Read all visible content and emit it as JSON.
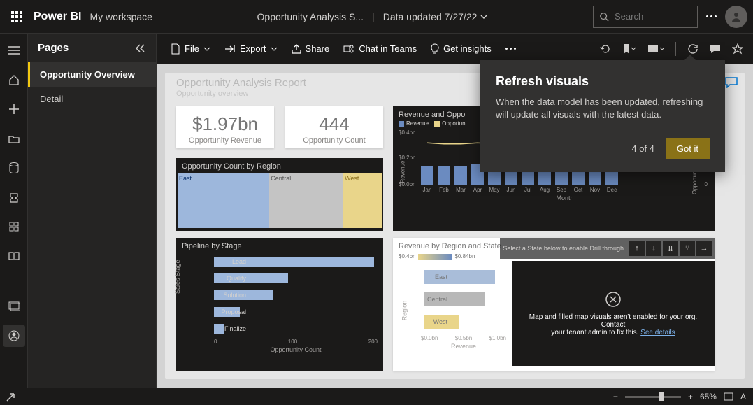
{
  "top": {
    "brand": "Power BI",
    "workspace": "My workspace",
    "report_name": "Opportunity Analysis S...",
    "data_updated": "Data updated 7/27/22",
    "search_placeholder": "Search"
  },
  "pages": {
    "title": "Pages",
    "items": [
      "Opportunity Overview",
      "Detail"
    ]
  },
  "commands": {
    "file": "File",
    "export": "Export",
    "share": "Share",
    "chat": "Chat in Teams",
    "insights": "Get insights"
  },
  "report": {
    "title": "Opportunity Analysis Report",
    "subtitle": "Opportunity overview"
  },
  "kpi1": {
    "value": "$1.97bn",
    "label": "Opportunity Revenue"
  },
  "kpi2": {
    "value": "444",
    "label": "Opportunity Count"
  },
  "treemap": {
    "title": "Opportunity Count by Region",
    "east": "East",
    "central": "Central",
    "west": "West"
  },
  "pipeline": {
    "title": "Pipeline by Stage",
    "ylabel": "Sales Stage",
    "xlabel": "Opportunity Count",
    "ticks": [
      "0",
      "100",
      "200"
    ]
  },
  "combo": {
    "title": "Revenue and Oppo",
    "legend_rev": "Revenue",
    "legend_opp": "Opportuni",
    "ylabel": "Revenue",
    "ylabel2": "Opportunity Count",
    "ytick1": "$0.4bn",
    "ytick2": "$0.2bn",
    "ytick3": "$0.0bn",
    "ytick_r": "0",
    "xlabel": "Month"
  },
  "region": {
    "title": "Revenue by Region and State",
    "g_lo": "$0.4bn",
    "g_hi": "$0.84bn",
    "ylabel": "Region",
    "xticks": [
      "$0.0bn",
      "$0.5bn",
      "$1.0bn"
    ],
    "xlabel": "Revenue",
    "east": "East",
    "central": "Central",
    "west": "West"
  },
  "map": {
    "head_text": "Select a State below to enable Drill through",
    "err1": "Map and filled map visuals aren't enabled for your org. Contact",
    "err2": "your tenant admin to fix this.",
    "link": "See details"
  },
  "callout": {
    "title": "Refresh visuals",
    "body": "When the data model has been updated, refreshing will update all visuals with the latest data.",
    "step": "4 of 4",
    "button": "Got it"
  },
  "status": {
    "zoom": "65%"
  },
  "chart_data": [
    {
      "type": "bar",
      "title": "Pipeline by Stage",
      "orientation": "horizontal",
      "xlabel": "Opportunity Count",
      "ylabel": "Sales Stage",
      "categories": [
        "Lead",
        "Qualify",
        "Solution",
        "Proposal",
        "Finalize"
      ],
      "values": [
        215,
        100,
        80,
        35,
        14
      ],
      "xlim": [
        0,
        220
      ]
    },
    {
      "type": "bar",
      "title": "Revenue and Opportunity Count by Month",
      "xlabel": "Month",
      "ylabel": "Revenue",
      "categories": [
        "Jan",
        "Feb",
        "Mar",
        "Apr",
        "May",
        "Jun",
        "Jul",
        "Aug",
        "Sep",
        "Oct",
        "Nov",
        "Dec"
      ],
      "series": [
        {
          "name": "Revenue",
          "type": "bar",
          "values": [
            0.16,
            0.16,
            0.16,
            0.17,
            0.16,
            0.17,
            0.18,
            0.16,
            0.16,
            0.18,
            0.17,
            0.17
          ],
          "unit": "bn"
        },
        {
          "name": "Opportunity Count",
          "type": "line",
          "values": [
            38,
            37,
            37,
            38,
            37,
            37,
            36,
            34,
            35,
            39,
            38,
            38
          ]
        }
      ],
      "ylim": [
        0,
        0.45
      ],
      "y2lim": [
        0,
        50
      ]
    },
    {
      "type": "bar",
      "title": "Revenue by Region and State",
      "orientation": "horizontal",
      "xlabel": "Revenue",
      "ylabel": "Region",
      "categories": [
        "East",
        "Central",
        "West"
      ],
      "values": [
        0.84,
        0.72,
        0.41
      ],
      "unit": "bn",
      "xlim": [
        0,
        1.0
      ]
    },
    {
      "type": "treemap",
      "title": "Opportunity Count by Region",
      "categories": [
        "East",
        "Central",
        "West"
      ],
      "values": [
        200,
        160,
        84
      ]
    }
  ]
}
